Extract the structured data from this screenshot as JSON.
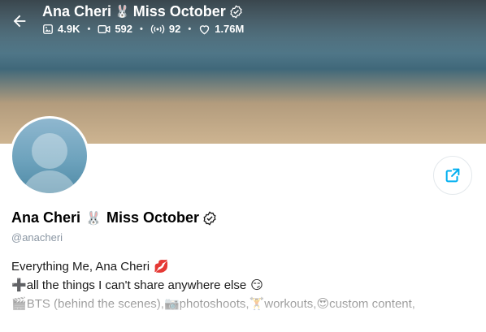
{
  "header": {
    "name": "Ana Cheri",
    "name_emoji": "🐰",
    "name_suffix": "Miss October",
    "back_icon": "arrow-left-icon",
    "verified_icon": "verified-badge-icon"
  },
  "stats": [
    {
      "icon": "image-icon",
      "value": "4.9K"
    },
    {
      "icon": "video-icon",
      "value": "592"
    },
    {
      "icon": "live-broadcast-icon",
      "value": "92"
    },
    {
      "icon": "heart-icon",
      "value": "1.76M"
    }
  ],
  "profile": {
    "name": "Ana Cheri",
    "name_emoji": "🐰",
    "name_suffix": "Miss October",
    "handle": "@anacheri",
    "share_icon": "share-icon"
  },
  "bio": {
    "line1_text": "Everything Me, Ana Cheri",
    "line1_emoji": "💋",
    "line2_emoji": "➕",
    "line2_text": "all the things I can't share anywhere else",
    "line2_end_emoji": "😏",
    "line3": [
      {
        "emoji": "🎬",
        "text": "BTS (behind the scenes), "
      },
      {
        "emoji": "📷",
        "text": "photoshoots, "
      },
      {
        "emoji": "🏋",
        "text": "workouts, "
      },
      {
        "emoji": "😍",
        "text": "custom content,"
      }
    ]
  },
  "colors": {
    "accent": "#00aff0",
    "text_primary": "#000000",
    "text_muted": "#8a96a3",
    "header_text": "#ffffff"
  }
}
